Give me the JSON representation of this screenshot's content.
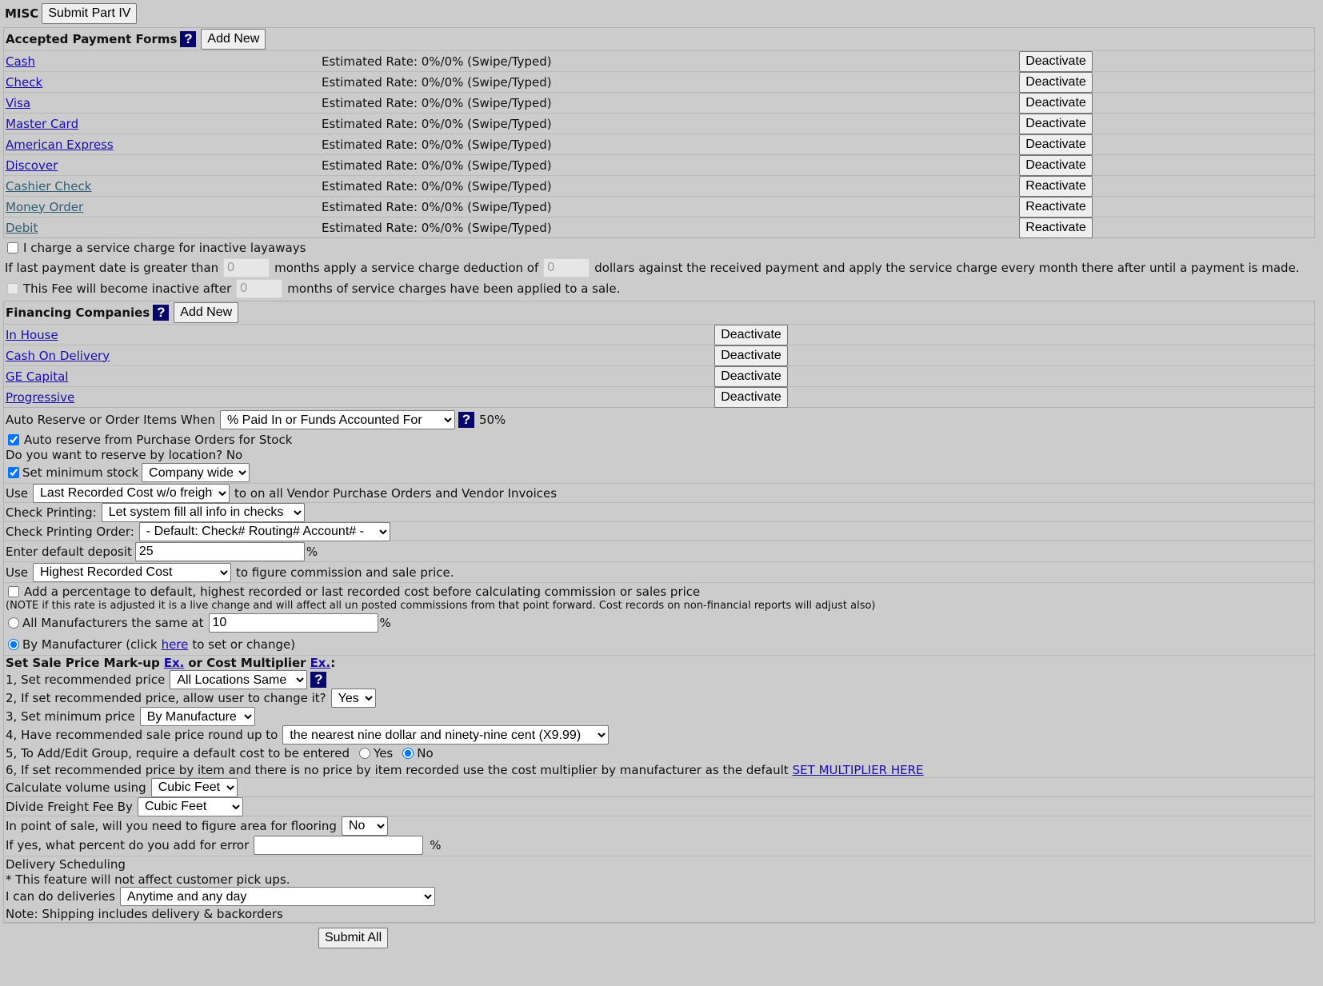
{
  "misc": {
    "title": "MISC",
    "submit_part": "Submit Part IV"
  },
  "payments": {
    "title": "Accepted Payment Forms",
    "add_new": "Add New",
    "help": "?",
    "items": [
      {
        "name": "Cash",
        "rate": "Estimated Rate: 0%/0% (Swipe/Typed)",
        "action": "Deactivate"
      },
      {
        "name": "Check",
        "rate": "Estimated Rate: 0%/0% (Swipe/Typed)",
        "action": "Deactivate"
      },
      {
        "name": "Visa",
        "rate": "Estimated Rate: 0%/0% (Swipe/Typed)",
        "action": "Deactivate"
      },
      {
        "name": "Master Card",
        "rate": "Estimated Rate: 0%/0% (Swipe/Typed)",
        "action": "Deactivate"
      },
      {
        "name": "American Express",
        "rate": "Estimated Rate: 0%/0% (Swipe/Typed)",
        "action": "Deactivate"
      },
      {
        "name": "Discover",
        "rate": "Estimated Rate: 0%/0% (Swipe/Typed)",
        "action": "Deactivate"
      },
      {
        "name": "Cashier Check",
        "rate": "Estimated Rate: 0%/0% (Swipe/Typed)",
        "action": "Reactivate"
      },
      {
        "name": "Money Order",
        "rate": "Estimated Rate: 0%/0% (Swipe/Typed)",
        "action": "Reactivate"
      },
      {
        "name": "Debit",
        "rate": "Estimated Rate: 0%/0% (Swipe/Typed)",
        "action": "Reactivate"
      }
    ]
  },
  "layaway": {
    "charge_label": "I charge a service charge for inactive layaways",
    "charge_checked": false,
    "months_prefix": "If last payment date is greater than",
    "months_value": "0",
    "months_mid": "months apply a service charge deduction of",
    "dollars_value": "0",
    "months_suffix": "dollars against the received payment and apply the service charge every month there after until a payment is made.",
    "inactive_prefix": "This Fee will become inactive after",
    "inactive_value": "0",
    "inactive_suffix": "months of service charges have been applied to a sale."
  },
  "financing": {
    "title": "Financing Companies",
    "add_new": "Add New",
    "items": [
      {
        "name": "In House",
        "action": "Deactivate"
      },
      {
        "name": "Cash On Delivery",
        "action": "Deactivate"
      },
      {
        "name": "GE Capital",
        "action": "Deactivate"
      },
      {
        "name": "Progressive",
        "action": "Deactivate"
      }
    ]
  },
  "reserve": {
    "label": "Auto Reserve or Order Items When",
    "select": "% Paid In or Funds Accounted For",
    "percent": "50%",
    "auto_po_label": "Auto reserve from Purchase Orders for Stock",
    "auto_po_checked": true,
    "by_location": "Do you want to reserve by location? No",
    "min_stock_label": "Set minimum stock",
    "min_stock_checked": true,
    "min_stock_select": "Company wide"
  },
  "cost": {
    "use_prefix": "Use",
    "use_select": "Last Recorded Cost w/o freight",
    "use_suffix": "to on all Vendor Purchase Orders and Vendor Invoices",
    "check_printing_label": "Check Printing:",
    "check_printing_select": "Let system fill all info in checks",
    "check_order_label": "Check Printing Order:",
    "check_order_select": "- Default: Check# Routing# Account# -",
    "deposit_label": "Enter default deposit",
    "deposit_value": "25",
    "deposit_unit": "%",
    "commission_prefix": "Use",
    "commission_select": "Highest Recorded Cost",
    "commission_suffix": "to figure commission and sale price.",
    "add_pct_label": "Add a percentage to default, highest recorded or last recorded cost before calculating commission or sales price",
    "add_pct_note": "(NOTE if this rate is adjusted it is a live change and will affect all un posted commissions from that point forward. Cost records on non-financial reports will adjust also)",
    "all_mfr_label": "All Manufacturers the same at",
    "all_mfr_value": "10",
    "all_mfr_unit": "%",
    "by_mfr_prefix": "By Manufacturer (click",
    "by_mfr_link": "here",
    "by_mfr_suffix": "to set or change)"
  },
  "markup": {
    "title_a": "Set Sale Price Mark-up",
    "ex_link": "Ex.",
    "title_b": "or Cost Multiplier",
    "ex_link2": "Ex.",
    "colon": ":",
    "q1_label": "1, Set recommended price",
    "q1_select": "All Locations Same",
    "q2_label": "2, If set recommended price, allow user to change it?",
    "q2_select": "Yes",
    "q3_label": "3, Set minimum price",
    "q3_select": "By Manufacture",
    "q4_label": "4, Have recommended sale price round up to",
    "q4_select": "the nearest nine dollar and ninety-nine cent (X9.99)",
    "q5_label": "5, To Add/Edit Group, require a default cost to be entered",
    "q5_yes": "Yes",
    "q5_no": "No",
    "q6_label": "6, If set recommended price by item and there is no price by item recorded use the cost multiplier by manufacturer as the default",
    "q6_link": "SET MULTIPLIER HERE"
  },
  "volume": {
    "calc_label": "Calculate volume using",
    "calc_select": "Cubic Feet",
    "freight_label": "Divide Freight Fee By",
    "freight_select": "Cubic Feet",
    "flooring_label": "In point of sale, will you need to figure area for flooring",
    "flooring_select": "No",
    "error_label": "If yes, what percent do you add for error",
    "error_value": "",
    "error_unit": "%"
  },
  "delivery": {
    "title": "Delivery Scheduling",
    "note1": "* This feature will not affect customer pick ups.",
    "can_label": "I can do deliveries",
    "can_select": "Anytime and any day",
    "note2": "Note: Shipping includes delivery & backorders"
  },
  "footer": {
    "submit_all": "Submit All"
  }
}
